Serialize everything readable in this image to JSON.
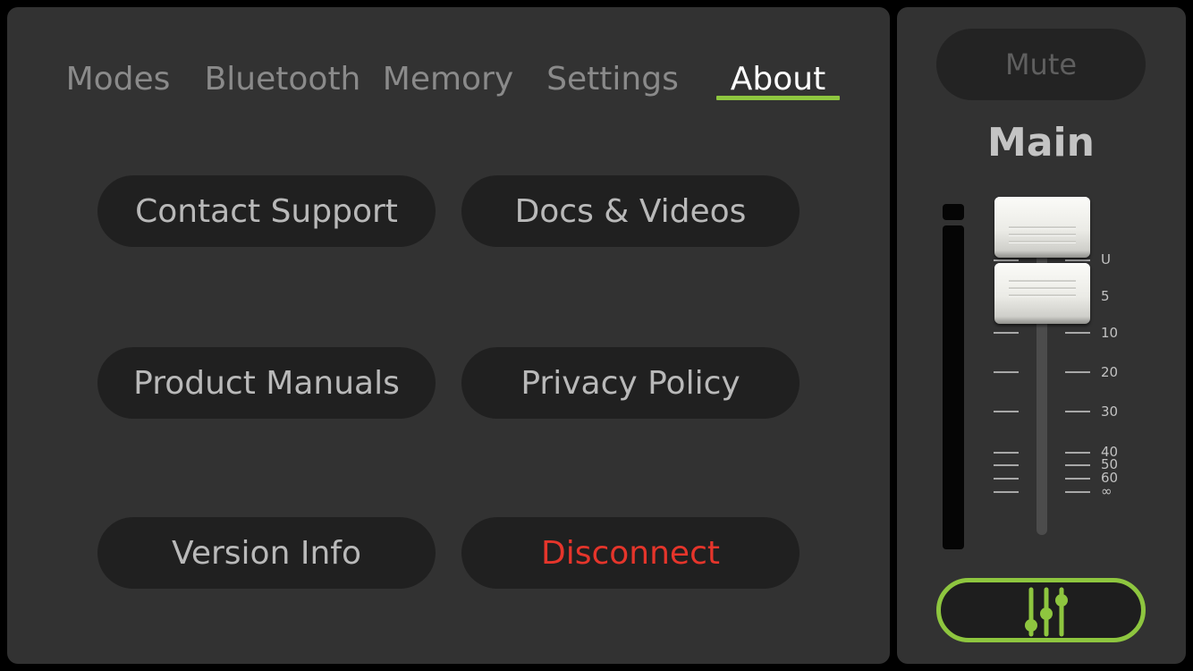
{
  "tabs": [
    {
      "label": "Modes",
      "active": false
    },
    {
      "label": "Bluetooth",
      "active": false
    },
    {
      "label": "Memory",
      "active": false
    },
    {
      "label": "Settings",
      "active": false
    },
    {
      "label": "About",
      "active": true
    }
  ],
  "about_buttons": {
    "contact_support": "Contact Support",
    "docs_videos": "Docs & Videos",
    "product_manuals": "Product Manuals",
    "privacy_policy": "Privacy Policy",
    "version_info": "Version Info",
    "disconnect": "Disconnect"
  },
  "channel": {
    "mute_label": "Mute",
    "name": "Main",
    "fader_scale": [
      "U",
      "5",
      "10",
      "20",
      "30",
      "40",
      "50",
      "60",
      "∞"
    ]
  },
  "icons": {
    "mixer": "mixer-sliders-icon"
  },
  "colors": {
    "accent": "#8ec63f",
    "danger": "#e5352b",
    "panel": "#323232",
    "button": "#202020"
  }
}
